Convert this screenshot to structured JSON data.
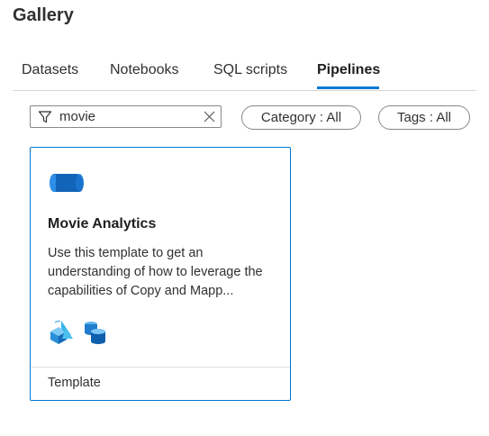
{
  "header": {
    "title": "Gallery"
  },
  "tabs": [
    {
      "label": "Datasets",
      "active": false
    },
    {
      "label": "Notebooks",
      "active": false
    },
    {
      "label": "SQL scripts",
      "active": false
    },
    {
      "label": "Pipelines",
      "active": true
    }
  ],
  "search": {
    "value": "movie",
    "icon": "filter-icon"
  },
  "filters": {
    "category_label": "Category : All",
    "tags_label": "Tags : All"
  },
  "cards": [
    {
      "icon": "pipeline-icon",
      "title": "Movie Analytics",
      "description": "Use this template to get an understanding of how to leverage the capabilities of Copy and Mapp...",
      "activity_icons": [
        "copy-data-icon",
        "data-flow-icon"
      ],
      "footer": "Template"
    }
  ],
  "colors": {
    "accent": "#0078d4",
    "text": "#323130",
    "border": "#8a8886"
  }
}
